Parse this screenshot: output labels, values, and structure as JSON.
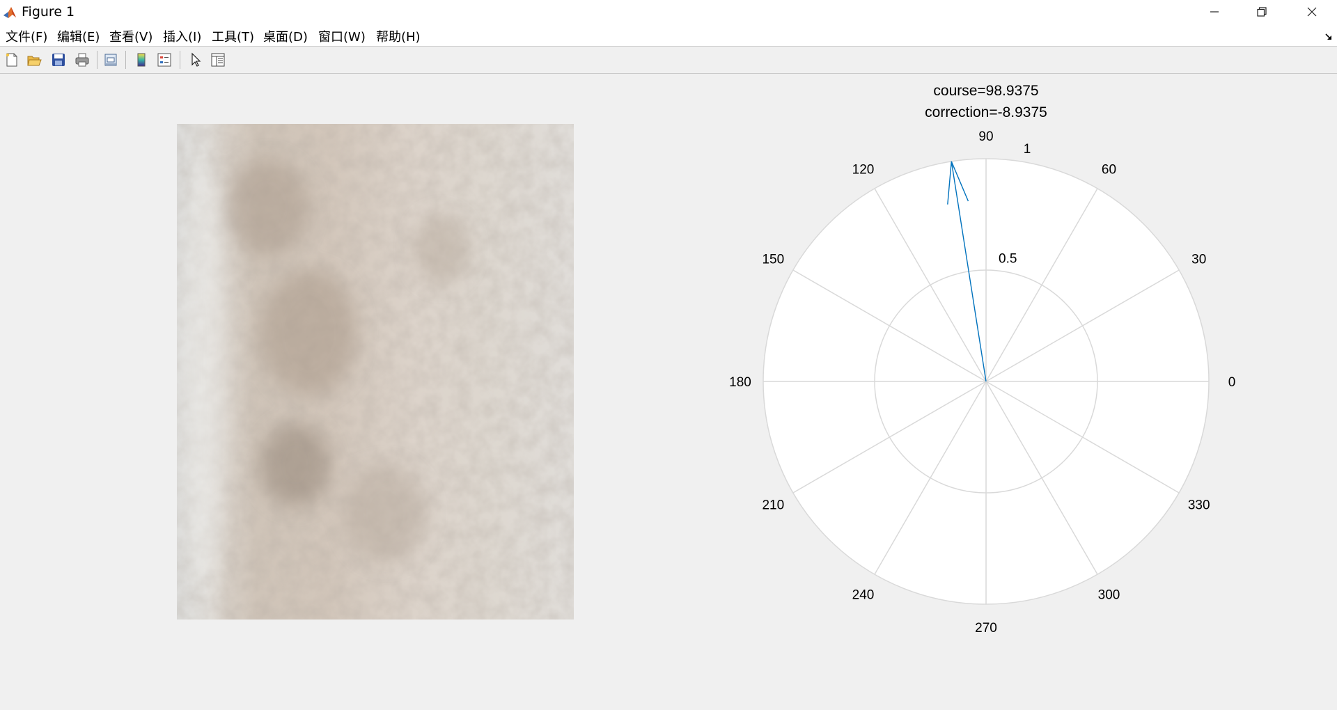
{
  "window": {
    "title": "Figure 1",
    "controls": {
      "minimize": "minimize",
      "maximize": "restore",
      "close": "close"
    }
  },
  "menu": {
    "items": [
      {
        "label": "文件(F)"
      },
      {
        "label": "编辑(E)"
      },
      {
        "label": "查看(V)"
      },
      {
        "label": "插入(I)"
      },
      {
        "label": "工具(T)"
      },
      {
        "label": "桌面(D)"
      },
      {
        "label": "窗口(W)"
      },
      {
        "label": "帮助(H)"
      }
    ]
  },
  "toolbar": {
    "buttons": [
      {
        "icon": "new-figure-icon"
      },
      {
        "icon": "open-file-icon"
      },
      {
        "icon": "save-icon"
      },
      {
        "icon": "print-icon"
      },
      {
        "icon": "link-plot-icon"
      },
      {
        "icon": "colorbar-icon"
      },
      {
        "icon": "legend-icon"
      },
      {
        "icon": "pointer-icon"
      },
      {
        "icon": "property-inspector-icon"
      }
    ]
  },
  "image_panel": {
    "description_icon": "image-axes",
    "colors": {
      "base": "#e6e0d9",
      "dark_band": "#c4b8ad",
      "light_edge": "#e3e1de"
    }
  },
  "polar": {
    "title_line1": "course=98.9375",
    "title_line2": "correction=-8.9375",
    "colors": {
      "grid": "#d9d9d9",
      "arrow": "#0072bd",
      "fill": "#ffffff"
    }
  },
  "chart_data": {
    "type": "polar",
    "title": [
      "course=98.9375",
      "correction=-8.9375"
    ],
    "theta_ticks": [
      "0",
      "30",
      "60",
      "90",
      "120",
      "150",
      "180",
      "210",
      "240",
      "270",
      "300",
      "330"
    ],
    "r_ticks": [
      "0.5",
      "1"
    ],
    "rlim": [
      0,
      1
    ],
    "series": [
      {
        "type": "compass-arrow",
        "theta_deg": 98.9375,
        "r": 1
      }
    ],
    "grid": true
  }
}
